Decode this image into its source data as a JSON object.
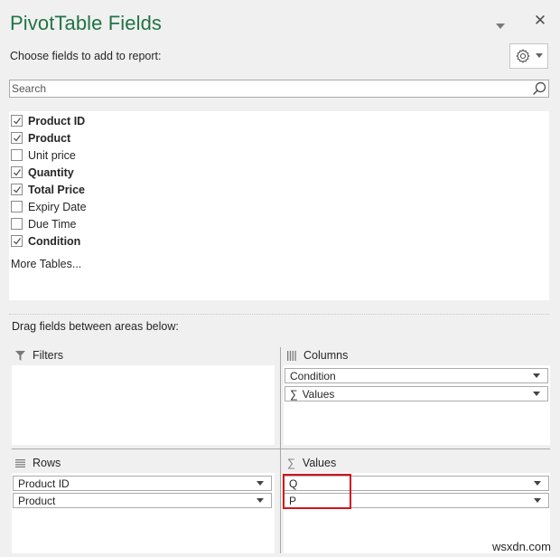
{
  "panel": {
    "title": "PivotTable Fields",
    "subtitle": "Choose fields to add to report:",
    "accent_color": "#217346",
    "header_icons": [
      "dropdown-arrow-icon",
      "close-icon",
      "gear-icon"
    ],
    "close_glyph": "✕"
  },
  "search": {
    "placeholder": "Search",
    "value": ""
  },
  "fields": [
    {
      "label": "Product ID",
      "checked": true
    },
    {
      "label": "Product",
      "checked": true
    },
    {
      "label": "Unit price",
      "checked": false
    },
    {
      "label": "Quantity",
      "checked": true
    },
    {
      "label": "Total Price",
      "checked": true
    },
    {
      "label": "Expiry Date",
      "checked": false
    },
    {
      "label": "Due Time",
      "checked": false
    },
    {
      "label": "Condition",
      "checked": true
    }
  ],
  "more_tables": "More Tables...",
  "drag_label": "Drag fields between areas below:",
  "areas": {
    "filters": {
      "label": "Filters",
      "icon": "filter-icon",
      "items": []
    },
    "columns": {
      "label": "Columns",
      "icon": "columns-icon",
      "items": [
        "Condition",
        "Values"
      ]
    },
    "rows": {
      "label": "Rows",
      "icon": "rows-icon",
      "items": [
        "Product ID",
        "Product"
      ]
    },
    "values": {
      "label": "Values",
      "icon": "sigma-icon",
      "items": [
        "Q",
        "P"
      ]
    }
  },
  "sigma_glyph": "∑",
  "highlight_color": "#d0161c",
  "watermark": "wsxdn.com"
}
